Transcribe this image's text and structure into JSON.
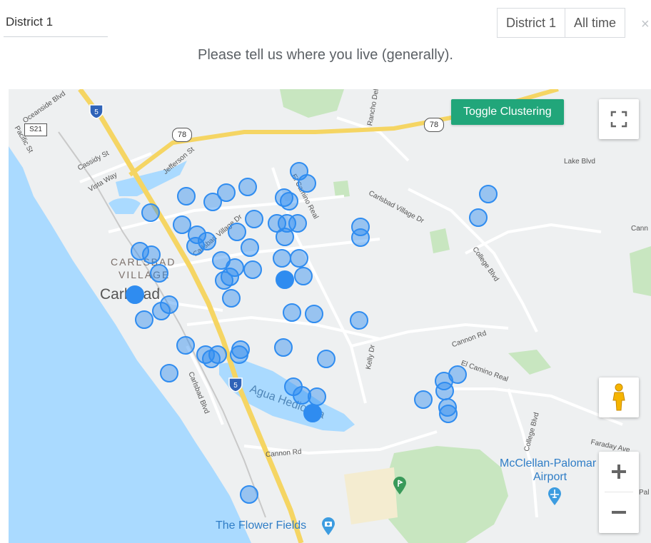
{
  "header": {
    "district_value": "District 1",
    "filters": [
      {
        "label": "District 1"
      },
      {
        "label": "All time"
      }
    ],
    "close_symbol": "×"
  },
  "question": "Please tell us where you live (generally).",
  "map": {
    "toggle_label": "Toggle Clustering",
    "controls": [
      "fullscreen-icon",
      "pegman-icon",
      "zoom-in-icon",
      "zoom-out-icon"
    ],
    "marker_color": "#2f8cf0",
    "labels": {
      "city": "Carlsbad",
      "village_line1": "CARLSBAD",
      "village_line2": "VILLAGE",
      "lagoon": "Agua Hedionda",
      "airport_line1": "McClellan-Palomar",
      "airport_line2": "Airport",
      "flower_fields": "The Flower Fields",
      "el_camino_real": "El Camino Real",
      "el_camino_real_2": "El Camino Real",
      "cannon_rd": "Cannon Rd",
      "cannon_rd_2": "Cannon Rd",
      "carlsbad_village_dr": "Carlsbad Village Dr",
      "carlsbad_village_dr_2": "Carlsbad Village Dr",
      "college_blvd": "College Blvd",
      "college_blvd_2": "College Blvd",
      "faraday_ave": "Faraday Ave",
      "lake_blvd": "Lake Blvd",
      "oceanside_blvd": "Oceanside Blvd",
      "jefferson_st": "Jefferson St",
      "cassidy_st": "Cassidy St",
      "vista_way": "Vista Way",
      "rancho_del_oro": "Rancho Del",
      "kelly_dr": "Kelly Dr",
      "carlsbad_blvd": "Carlsbad Blvd",
      "pacific_st": "Pacific St",
      "palomar": "Pal",
      "cannon": "Cann",
      "hwy_5": "5",
      "hwy_5b": "5",
      "hwy_78": "78",
      "hwy_78b": "78",
      "s21": "S21"
    }
  }
}
